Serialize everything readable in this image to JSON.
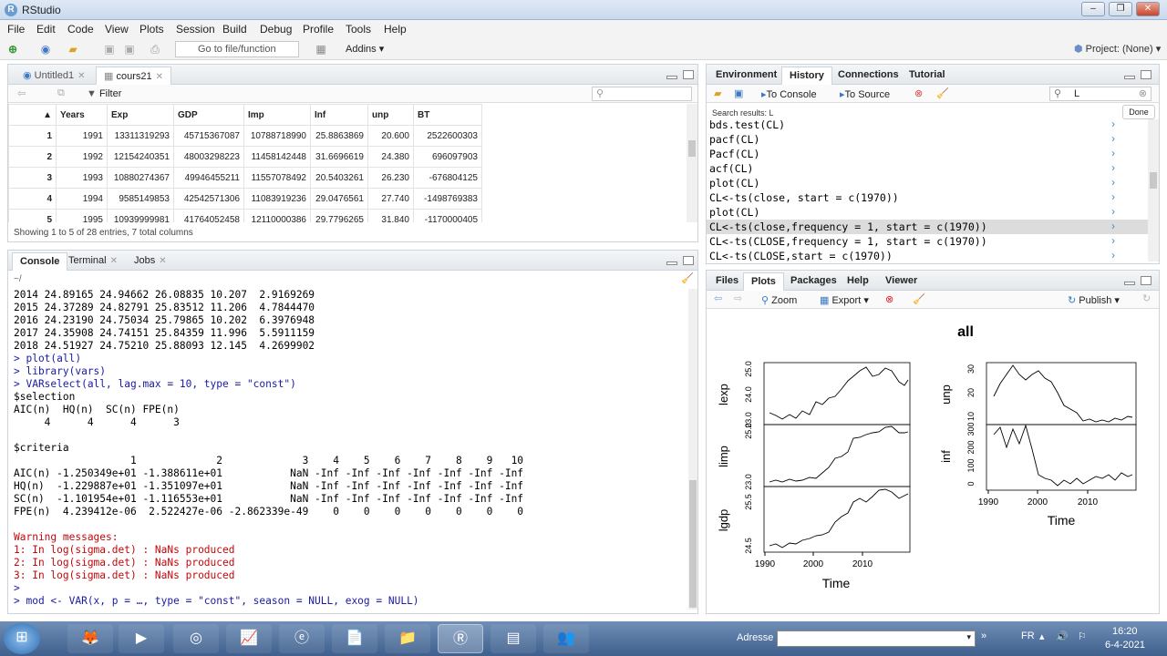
{
  "window": {
    "title": "RStudio"
  },
  "menu": [
    "File",
    "Edit",
    "Code",
    "View",
    "Plots",
    "Session",
    "Build",
    "Debug",
    "Profile",
    "Tools",
    "Help"
  ],
  "toolbar": {
    "goto_placeholder": "Go to file/function",
    "addins": "Addins",
    "project": "Project: (None)"
  },
  "source": {
    "tabs": [
      "Untitled1",
      "cours21"
    ],
    "filter_label": "Filter",
    "columns": [
      "",
      "Years",
      "Exp",
      "GDP",
      "Imp",
      "Inf",
      "unp",
      "BT"
    ],
    "rows": [
      [
        "1",
        "1991",
        "13311319293",
        "45715367087",
        "10788718990",
        "25.8863869",
        "20.600",
        "2522600303"
      ],
      [
        "2",
        "1992",
        "12154240351",
        "48003298223",
        "11458142448",
        "31.6696619",
        "24.380",
        "696097903"
      ],
      [
        "3",
        "1993",
        "10880274367",
        "49946455211",
        "11557078492",
        "20.5403261",
        "26.230",
        "-676804125"
      ],
      [
        "4",
        "1994",
        "9585149853",
        "42542571306",
        "11083919236",
        "29.0476561",
        "27.740",
        "-1498769383"
      ],
      [
        "5",
        "1995",
        "10939999981",
        "41764052458",
        "12110000386",
        "29.7796265",
        "31.840",
        "-1170000405"
      ]
    ],
    "status": "Showing 1 to 5 of 28 entries, 7 total columns"
  },
  "console": {
    "tabs": [
      "Console",
      "Terminal",
      "Jobs"
    ],
    "path": "~/",
    "lines": [
      {
        "t": "2014 24.89165 24.94662 26.08835 10.207  2.9169269",
        "c": ""
      },
      {
        "t": "2015 24.37289 24.82791 25.83512 11.206  4.7844470",
        "c": ""
      },
      {
        "t": "2016 24.23190 24.75034 25.79865 10.202  6.3976948",
        "c": ""
      },
      {
        "t": "2017 24.35908 24.74151 25.84359 11.996  5.5911159",
        "c": ""
      },
      {
        "t": "2018 24.51927 24.75210 25.88093 12.145  4.2699902",
        "c": ""
      },
      {
        "t": "> plot(all)",
        "c": "c-blue"
      },
      {
        "t": "> library(vars)",
        "c": "c-blue"
      },
      {
        "t": "> VARselect(all, lag.max = 10, type = \"const\")",
        "c": "c-blue"
      },
      {
        "t": "$selection",
        "c": ""
      },
      {
        "t": "AIC(n)  HQ(n)  SC(n) FPE(n) ",
        "c": ""
      },
      {
        "t": "     4      4      4      3 ",
        "c": ""
      },
      {
        "t": "",
        "c": ""
      },
      {
        "t": "$criteria",
        "c": ""
      },
      {
        "t": "                   1             2             3    4    5    6    7    8    9   10",
        "c": ""
      },
      {
        "t": "AIC(n) -1.250349e+01 -1.388611e+01           NaN -Inf -Inf -Inf -Inf -Inf -Inf -Inf",
        "c": ""
      },
      {
        "t": "HQ(n)  -1.229887e+01 -1.351097e+01           NaN -Inf -Inf -Inf -Inf -Inf -Inf -Inf",
        "c": ""
      },
      {
        "t": "SC(n)  -1.101954e+01 -1.116553e+01           NaN -Inf -Inf -Inf -Inf -Inf -Inf -Inf",
        "c": ""
      },
      {
        "t": "FPE(n)  4.239412e-06  2.522427e-06 -2.862339e-49    0    0    0    0    0    0    0",
        "c": ""
      },
      {
        "t": "",
        "c": ""
      },
      {
        "t": "Warning messages:",
        "c": "c-red"
      },
      {
        "t": "1: In log(sigma.det) : NaNs produced",
        "c": "c-red"
      },
      {
        "t": "2: In log(sigma.det) : NaNs produced",
        "c": "c-red"
      },
      {
        "t": "3: In log(sigma.det) : NaNs produced",
        "c": "c-red"
      },
      {
        "t": ">",
        "c": "c-blue"
      },
      {
        "t": "> mod <- VAR(x, p = …, type = \"const\", season = NULL, exog = NULL)",
        "c": "c-blue"
      }
    ]
  },
  "environment": {
    "tabs": [
      "Environment",
      "History",
      "Connections",
      "Tutorial"
    ],
    "to_console": "To Console",
    "to_source": "To Source",
    "search_value": "L",
    "done": "Done",
    "search_results": "Search results: L",
    "history": [
      "bds.test(CL)",
      "pacf(CL)",
      "Pacf(CL)",
      "acf(CL)",
      "plot(CL)",
      "CL<-ts(close, start = c(1970))",
      "plot(CL)",
      "CL<-ts(close,frequency = 1, start = c(1970))",
      "CL<-ts(CLOSE,frequency = 1, start = c(1970))",
      "CL<-ts(CLOSE,start = c(1970))"
    ],
    "selected_index": 7
  },
  "plots": {
    "tabs": [
      "Files",
      "Plots",
      "Packages",
      "Help",
      "Viewer"
    ],
    "zoom": "Zoom",
    "export": "Export",
    "publish": "Publish",
    "plot_title": "all",
    "left_labels": [
      "lexp",
      "limp",
      "lgdp"
    ],
    "right_labels": [
      "unp",
      "inf"
    ],
    "x_ticks": [
      "1990",
      "2000",
      "2010"
    ],
    "x_label": "Time",
    "ticks_lexp": [
      "25.0",
      "24.0",
      "23.0"
    ],
    "ticks_limp": [
      "25.0",
      "23.0"
    ],
    "ticks_lgdp": [
      "25.5",
      "24.5"
    ],
    "ticks_unp": [
      "30",
      "20",
      "10"
    ],
    "ticks_inf": [
      "300",
      "200",
      "100",
      "0"
    ]
  },
  "taskbar": {
    "lang": "FR",
    "address_label": "Adresse",
    "time": "16:20",
    "date": "6-4-2021"
  }
}
